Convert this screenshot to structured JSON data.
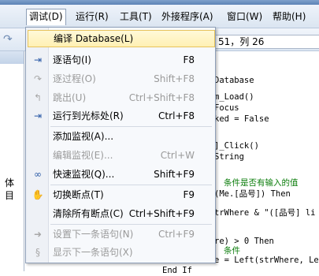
{
  "window": {
    "title": ""
  },
  "menubar": {
    "items": [
      {
        "label": "调试(D)"
      },
      {
        "label": "运行(R)"
      },
      {
        "label": "工具(T)"
      },
      {
        "label": "外接程序(A)"
      },
      {
        "label": "窗口(W)"
      },
      {
        "label": "帮助(H)"
      }
    ]
  },
  "toolbar": {
    "position_readout": "51，列 26"
  },
  "left_pane": {
    "text1": "体",
    "text2": "目"
  },
  "code": {
    "lines": [
      "Database",
      "",
      "m_Load()",
      "Focus",
      "ked = False",
      "",
      "",
      "]_Click()",
      " String",
      "",
      "",
      "条件是否有输入的值",
      "(Me.[品号]) Then",
      "",
      "trWhere & \"([品号] li",
      "",
      "",
      "re) > 0 Then",
      "条件",
      "e = Left(strWhere, Len",
      "End If"
    ]
  },
  "debug_menu": {
    "items": [
      {
        "label": "编译 Database(L)",
        "shortcut": "",
        "icon": "none",
        "enabled": true,
        "highlighted": true
      },
      {
        "label": "逐语句(I)",
        "shortcut": "F8",
        "icon": "step-into-icon",
        "enabled": true
      },
      {
        "label": "逐过程(O)",
        "shortcut": "Shift+F8",
        "icon": "step-over-icon",
        "enabled": false
      },
      {
        "label": "跳出(U)",
        "shortcut": "Ctrl+Shift+F8",
        "icon": "step-out-icon",
        "enabled": false
      },
      {
        "label": "运行到光标处(R)",
        "shortcut": "Ctrl+F8",
        "icon": "run-to-cursor-icon",
        "enabled": true
      },
      {
        "label": "添加监视(A)...",
        "shortcut": "",
        "icon": "none",
        "enabled": true
      },
      {
        "label": "编辑监视(E)...",
        "shortcut": "Ctrl+W",
        "icon": "none",
        "enabled": false
      },
      {
        "label": "快速监视(Q)...",
        "shortcut": "Shift+F9",
        "icon": "quick-watch-icon",
        "enabled": true
      },
      {
        "label": "切换断点(T)",
        "shortcut": "F9",
        "icon": "breakpoint-hand-icon",
        "enabled": true
      },
      {
        "label": "清除所有断点(C)",
        "shortcut": "Ctrl+Shift+F9",
        "icon": "none",
        "enabled": true
      },
      {
        "label": "设置下一条语句(N)",
        "shortcut": "Ctrl+F9",
        "icon": "set-next-statement-icon",
        "enabled": false
      },
      {
        "label": "显示下一条语句(X)",
        "shortcut": "",
        "icon": "show-next-statement-icon",
        "enabled": false
      }
    ]
  }
}
